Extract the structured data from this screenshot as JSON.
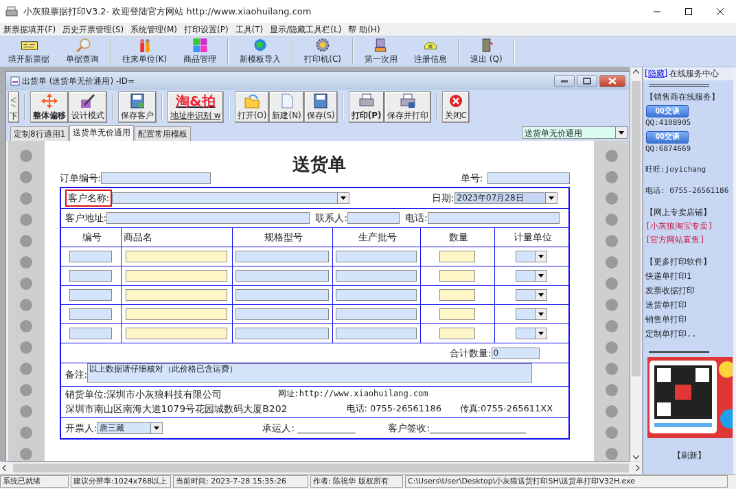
{
  "window": {
    "title": "小灰狼票据打印V3.2- 欢迎登陆官方网站 http://www.xiaohuilang.com"
  },
  "menu": [
    "新票据填开(F)",
    "历史开票管理(S)",
    "系统管理(M)",
    "打印设置(P)",
    "工具(T)",
    "显示/隐藏工具栏(L)",
    "帮 助(H)"
  ],
  "toolbar": [
    [
      "填开新票据",
      "单据查询"
    ],
    [
      "往来单位(K)",
      "商品管理"
    ],
    [
      "新模板导入"
    ],
    [
      "打印机(C)"
    ],
    [
      "第一次用",
      "注册信息"
    ],
    [
      "退出 (Q)"
    ]
  ],
  "child": {
    "title": "出货单 (送货单无价通用) -ID=",
    "scroller_label": "下",
    "toolbar": [
      [
        {
          "label": "整体偏移",
          "bold": true
        },
        {
          "label": "设计模式",
          "bold": false
        }
      ],
      [
        {
          "label": "保存客户",
          "bold": false
        }
      ],
      [
        {
          "label": "地址串识别 w",
          "bold": false,
          "logo": "淘&拍"
        }
      ],
      [
        {
          "label": "打开(O)",
          "bold": false
        },
        {
          "label": "新建(N)",
          "bold": false
        },
        {
          "label": "保存(S)",
          "bold": false
        }
      ],
      [
        {
          "label": "打印(P)",
          "bold": true
        },
        {
          "label": "保存并打印",
          "bold": false
        }
      ],
      [
        {
          "label": "关闭C",
          "bold": false
        }
      ]
    ],
    "tabs": [
      {
        "label": "定制8行通用1",
        "selected": false
      },
      {
        "label": "送货单无价通用",
        "selected": true
      },
      {
        "label": "配置常用模板",
        "selected": false
      }
    ],
    "template": "送货单无价通用"
  },
  "form": {
    "title": "送货单",
    "order_label": "订单编号:",
    "number_label": "单号:",
    "customer_label": "客户名称:",
    "customer_highlighted": true,
    "date_label": "日期:",
    "date": "2023年07月28日",
    "address_label": "客户地址:",
    "contact_label": "联系人:",
    "phone_label": "电话:",
    "columns": [
      {
        "label": "编号",
        "kind": "input",
        "color": "#d4e4fb"
      },
      {
        "label": "商品名",
        "kind": "input",
        "color": "#fff6c8"
      },
      {
        "label": "规格型号",
        "kind": "input",
        "color": "#d4e4fb"
      },
      {
        "label": "生产批号",
        "kind": "input",
        "color": "#d4e4fb"
      },
      {
        "label": "数量",
        "kind": "input",
        "color": "#fff6c8"
      },
      {
        "label": "计量单位",
        "kind": "select",
        "color": "#d4e4fb"
      }
    ],
    "total_label": "合计数量:",
    "total": "0",
    "remark_label": "备注:",
    "remark": "以上数据请仔细核对（此价格已含运费）",
    "seller": "销货单位:深圳市小灰狼科技有限公司",
    "website": "网址:http://www.xiaohuilang.com",
    "address": "深圳市南山区南海大道1079号花园城数码大厦B202",
    "phone": "电话: 0755-26561186",
    "fax": "传真:0755-265611XX",
    "issuer_label": "开票人:",
    "issuer": "唐三藏",
    "carrier": "承运人: ____________",
    "sign": "客户签收:____________________"
  },
  "panel": {
    "hide_link": "[隐藏]",
    "title": "在线服务中心",
    "dealer_heading": "【销售商在线服务】",
    "qq": [
      {
        "button": "QQ交谈",
        "number": "QQ:4108905"
      },
      {
        "button": "QQ交谈",
        "number": "QQ:6874669"
      }
    ],
    "wangwang": "旺旺:joyichang",
    "phone": "电话: 0755-26561186",
    "shop_heading": "【网上专卖店铺】",
    "shops": [
      "[小灰狼淘宝专卖]",
      "[官方网站直售]"
    ],
    "more_heading": "【更多打印软件】",
    "more": [
      "快递单打印1",
      "发票收据打印",
      "送货单打印",
      "销售单打印",
      "定制单打印.."
    ],
    "refresh": "【刷新】"
  },
  "status_bar": [
    "系统已就绪",
    "建议分辨率:1024x768以上",
    "当前时间: 2023-7-28 15:35:26",
    "作者: 陈祝华 版权所有",
    "C:\\Users\\User\\Desktop\\小灰狼送货打印SH\\送货单打印V32H.exe"
  ]
}
